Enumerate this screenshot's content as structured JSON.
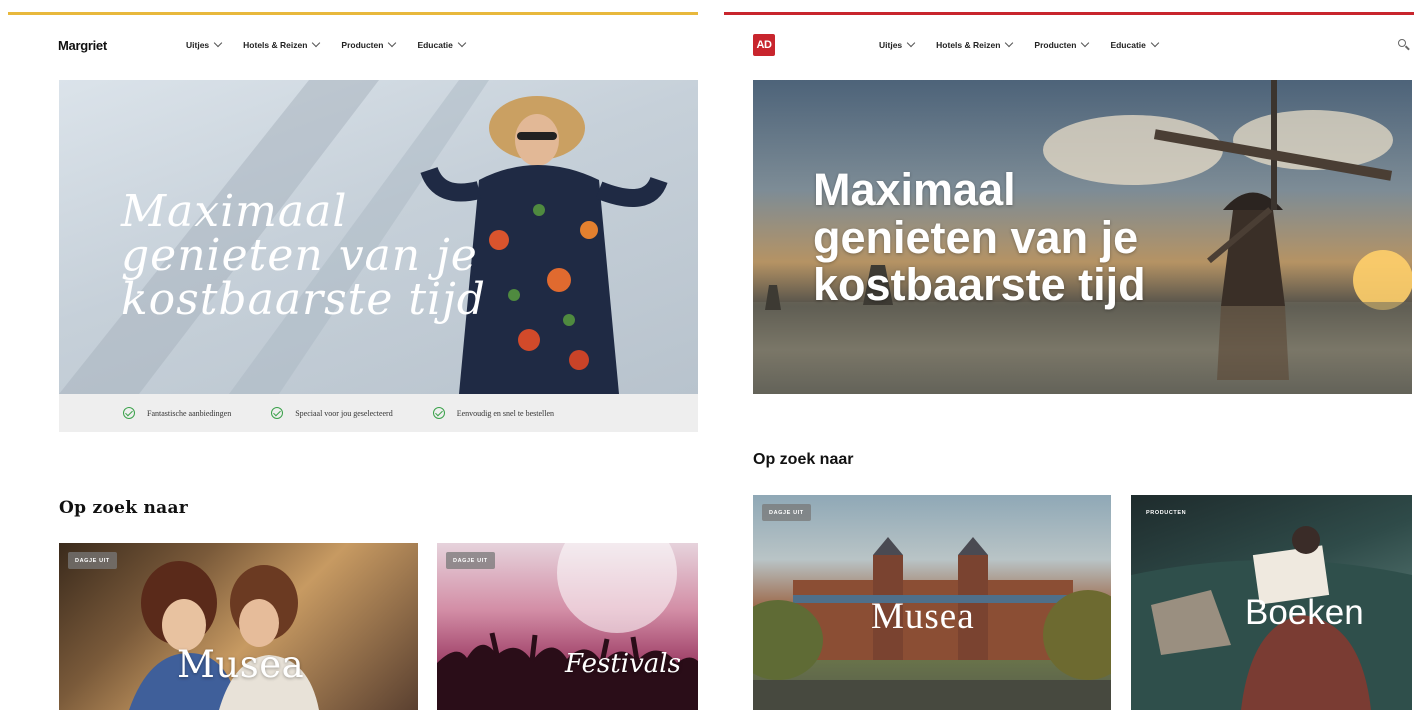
{
  "colors": {
    "margriet_accent": "#e8b83c",
    "ad_accent": "#c8252d",
    "check_green": "#3aa14a",
    "benefits_bg": "#eeeeee"
  },
  "left": {
    "logo": "Margriet",
    "nav": [
      {
        "label": "Uitjes",
        "icon": "chevron-down-icon"
      },
      {
        "label": "Hotels & Reizen",
        "icon": "chevron-down-icon"
      },
      {
        "label": "Producten",
        "icon": "chevron-down-icon"
      },
      {
        "label": "Educatie",
        "icon": "chevron-down-icon"
      }
    ],
    "hero": {
      "line1": "Maximaal",
      "line2": "genieten van je",
      "line3": "kostbaarste tijd"
    },
    "benefits": [
      "Fantastische aanbiedingen",
      "Speciaal voor jou geselecteerd",
      "Eenvoudig en snel te bestellen"
    ],
    "section_title": "Op zoek naar",
    "cards": [
      {
        "badge": "DAGJE UIT",
        "title": "Musea"
      },
      {
        "badge": "DAGJE UIT",
        "title": "Festivals"
      }
    ]
  },
  "right": {
    "logo": "AD",
    "nav": [
      {
        "label": "Uitjes",
        "icon": "chevron-down-icon"
      },
      {
        "label": "Hotels & Reizen",
        "icon": "chevron-down-icon"
      },
      {
        "label": "Producten",
        "icon": "chevron-down-icon"
      },
      {
        "label": "Educatie",
        "icon": "chevron-down-icon"
      }
    ],
    "search_icon": "search-icon",
    "hero": {
      "line1": "Maximaal",
      "line2": "genieten van je",
      "line3": "kostbaarste tijd"
    },
    "section_title": "Op zoek naar",
    "cards": [
      {
        "badge": "DAGJE UIT",
        "title": "Musea"
      },
      {
        "badge": "PRODUCTEN",
        "title": "Boeken"
      }
    ]
  }
}
